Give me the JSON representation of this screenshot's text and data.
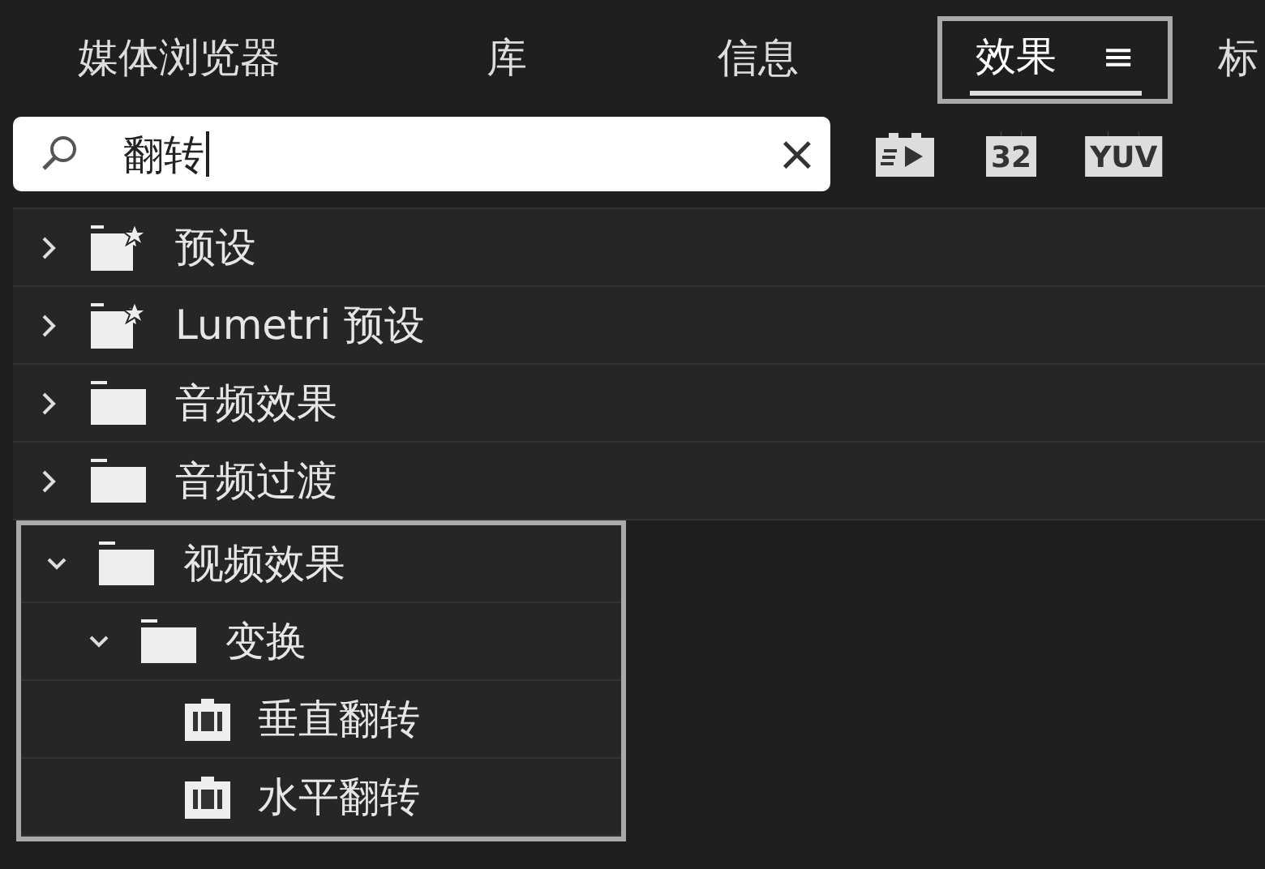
{
  "tabs": [
    {
      "label": "媒体浏览器",
      "selected": false,
      "highlighted": false
    },
    {
      "label": "库",
      "selected": false,
      "highlighted": false
    },
    {
      "label": "信息",
      "selected": false,
      "highlighted": false
    },
    {
      "label": "效果",
      "selected": true,
      "highlighted": true,
      "menu": "≡"
    },
    {
      "label": "标",
      "selected": false,
      "highlighted": false
    }
  ],
  "search": {
    "value": "翻转",
    "clear": "×"
  },
  "filter_buttons": [
    {
      "kind": "accelerated"
    },
    {
      "kind": "bitdepth",
      "label": "32"
    },
    {
      "kind": "yuv",
      "label": "YUV"
    }
  ],
  "tree": [
    {
      "label": "预设",
      "kind": "preset_folder",
      "expanded": false,
      "highlighted": false
    },
    {
      "label": "Lumetri 预设",
      "kind": "preset_folder",
      "expanded": false,
      "highlighted": false
    },
    {
      "label": "音频效果",
      "kind": "folder",
      "expanded": false,
      "highlighted": false
    },
    {
      "label": "音频过渡",
      "kind": "folder",
      "expanded": false,
      "highlighted": false
    },
    {
      "label": "视频效果",
      "kind": "folder",
      "expanded": true,
      "highlighted": true,
      "children": [
        {
          "label": "变换",
          "kind": "folder",
          "expanded": true,
          "children": [
            {
              "label": "垂直翻转",
              "kind": "effect"
            },
            {
              "label": "水平翻转",
              "kind": "effect"
            }
          ]
        }
      ]
    }
  ]
}
